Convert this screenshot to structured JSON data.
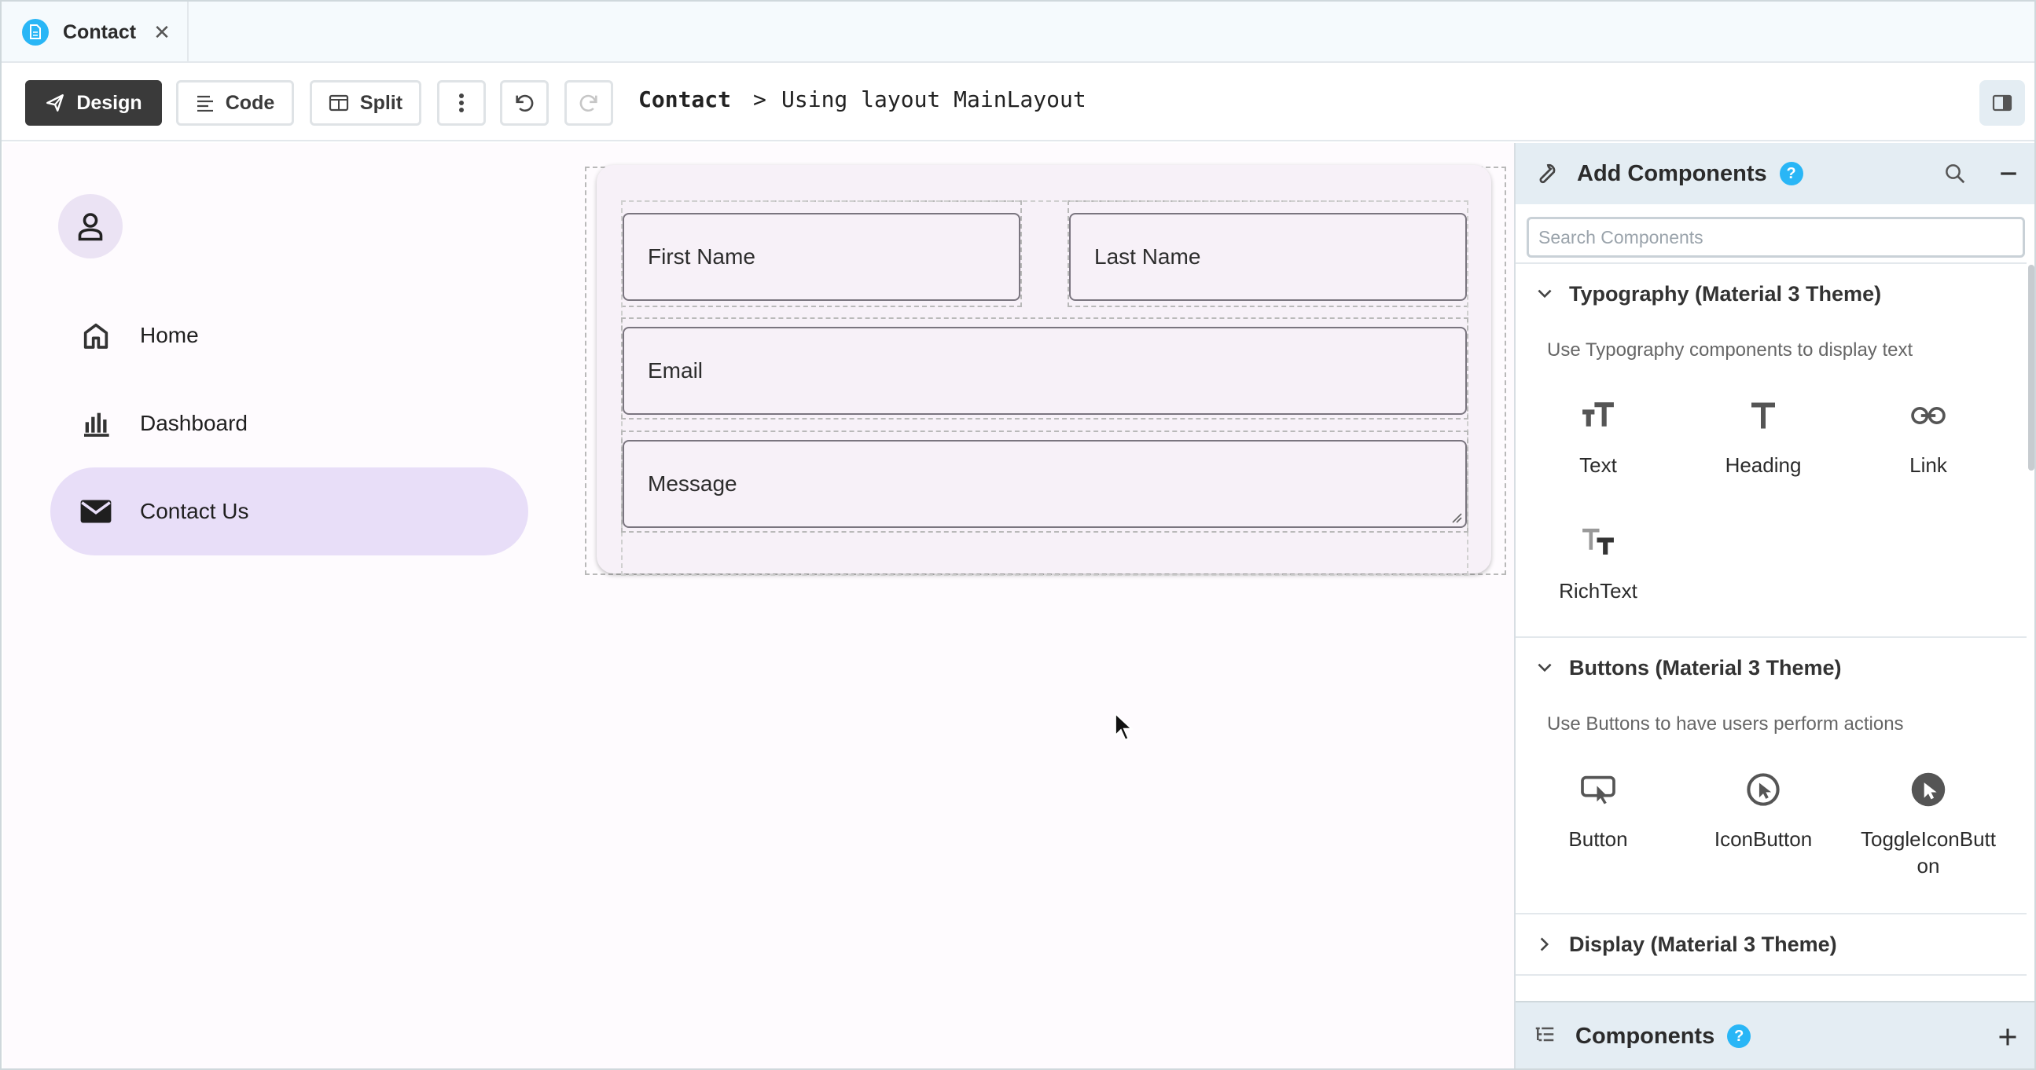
{
  "tab": {
    "label": "Contact",
    "close_symbol": "✕",
    "icon": "file-page-icon"
  },
  "toolbar": {
    "design_label": "Design",
    "code_label": "Code",
    "split_label": "Split",
    "breadcrumb_page": "Contact",
    "breadcrumb_separator": ">",
    "breadcrumb_layout": "Using layout MainLayout"
  },
  "nav": {
    "items": [
      {
        "label": "Home",
        "icon": "home-icon"
      },
      {
        "label": "Dashboard",
        "icon": "bar-chart-icon"
      },
      {
        "label": "Contact Us",
        "icon": "mail-icon",
        "active": true
      }
    ]
  },
  "form": {
    "first_name": "First Name",
    "last_name": "Last Name",
    "email": "Email",
    "message": "Message"
  },
  "panel": {
    "title": "Add Components",
    "help": "?",
    "search_placeholder": "Search Components",
    "sections": [
      {
        "title": "Typography (Material 3 Theme)",
        "description": "Use Typography components to display text",
        "items": [
          "Text",
          "Heading",
          "Link",
          "RichText"
        ]
      },
      {
        "title": "Buttons (Material 3 Theme)",
        "description": "Use Buttons to have users perform actions",
        "items": [
          "Button",
          "IconButton",
          "ToggleIconButt\non"
        ]
      },
      {
        "title": "Display (Material 3 Theme)"
      }
    ],
    "footer_title": "Components",
    "footer_help": "?"
  },
  "colors": {
    "accent": "#29b6f6",
    "active_nav": "#e8def8",
    "panel_header": "#e4edf3",
    "primary_button": "#3a3a3a"
  }
}
